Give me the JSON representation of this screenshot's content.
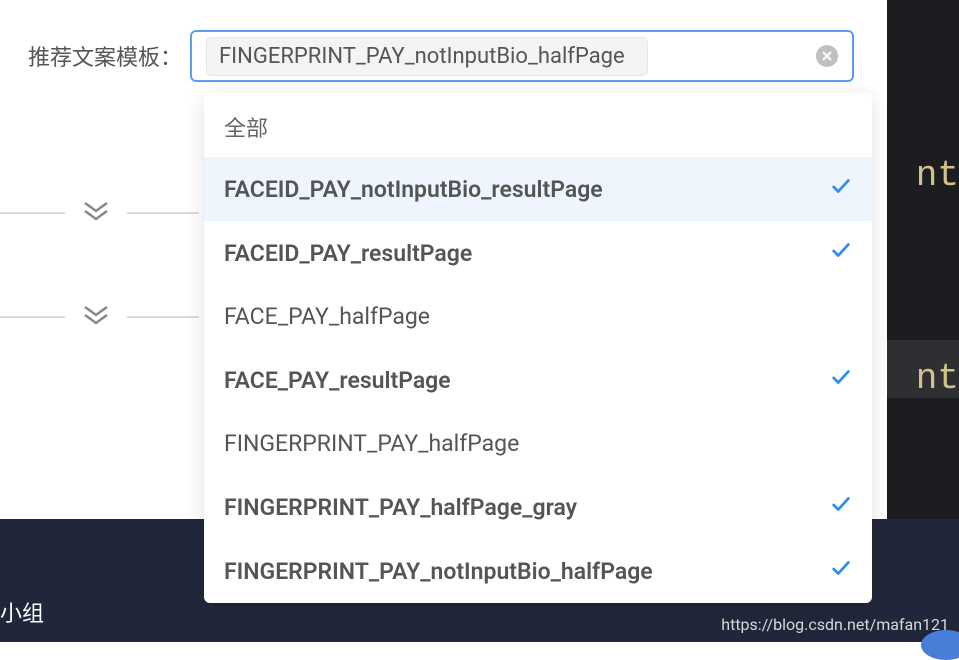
{
  "form": {
    "label": "推荐文案模板：",
    "selected_tag": "FINGERPRINT_PAY_notInputBio_halfPage"
  },
  "dropdown": {
    "header": "全部",
    "options": [
      {
        "label": "FACEID_PAY_notInputBio_resultPage",
        "selected": true
      },
      {
        "label": "FACEID_PAY_resultPage",
        "selected": true
      },
      {
        "label": "FACE_PAY_halfPage",
        "selected": false
      },
      {
        "label": "FACE_PAY_resultPage",
        "selected": true
      },
      {
        "label": "FINGERPRINT_PAY_halfPage",
        "selected": false
      },
      {
        "label": "FINGERPRINT_PAY_halfPage_gray",
        "selected": true
      },
      {
        "label": "FINGERPRINT_PAY_notInputBio_halfPage",
        "selected": true
      }
    ]
  },
  "footer": {
    "left_text": "小组",
    "right_text": "https://blog.csdn.net/mafan121"
  },
  "right_edge": {
    "text1": "nt",
    "text2": "nt"
  }
}
